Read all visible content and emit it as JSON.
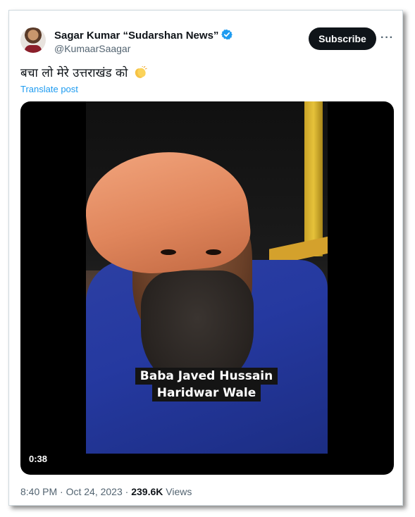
{
  "author": {
    "display_name": "Sagar Kumar “Sudarshan News”",
    "handle": "@KumaarSaagar",
    "verified_icon": "verified-badge-icon",
    "verified_color": "#1d9bf0"
  },
  "actions": {
    "subscribe_label": "Subscribe",
    "more_label": "···"
  },
  "post": {
    "text": "बचा लो मेरे उत्तराखंड को",
    "emoji_icon": "clapping-hands-icon",
    "translate_label": "Translate post"
  },
  "video": {
    "caption_line1": "Baba Javed Hussain",
    "caption_line2": "Haridwar Wale",
    "duration": "0:38"
  },
  "meta": {
    "time": "8:40 PM",
    "sep1": " · ",
    "date": "Oct 24, 2023",
    "sep2": " · ",
    "views_count": "239.6K",
    "views_label": " Views"
  },
  "colors": {
    "accent": "#1d9bf0",
    "text_primary": "#0f1419",
    "text_secondary": "#536471",
    "button_bg": "#0f1419"
  }
}
